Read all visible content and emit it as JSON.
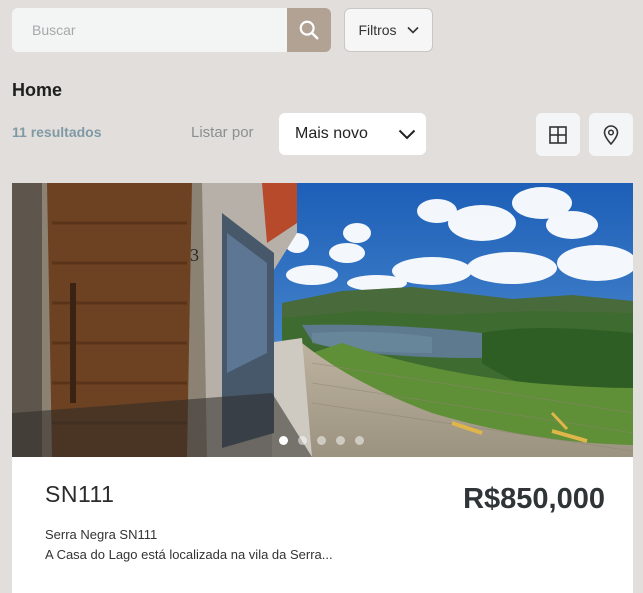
{
  "search": {
    "placeholder": "Buscar",
    "value": ""
  },
  "filters": {
    "label": "Filtros"
  },
  "page": {
    "title": "Home"
  },
  "listing": {
    "results_count": "11 resultados",
    "sort_label": "Listar por",
    "sort_value": "Mais novo"
  },
  "icons": {
    "search": "search-icon",
    "filters_chevron": "chevron-down-icon",
    "sort_chevron": "chevron-down-icon",
    "grid_view": "grid-icon",
    "map_view": "map-pin-icon"
  },
  "colors": {
    "background": "#e2dedb",
    "search_button": "#b1a293",
    "results_text": "#7f9aa4",
    "price_text": "#2f3437"
  },
  "property": {
    "code": "SN111",
    "price": "R$850,000",
    "subtitle": "Serra Negra SN111",
    "description": "A Casa do Lago está localizada na vila da Serra...",
    "carousel": {
      "total": 5,
      "active": 1
    }
  }
}
